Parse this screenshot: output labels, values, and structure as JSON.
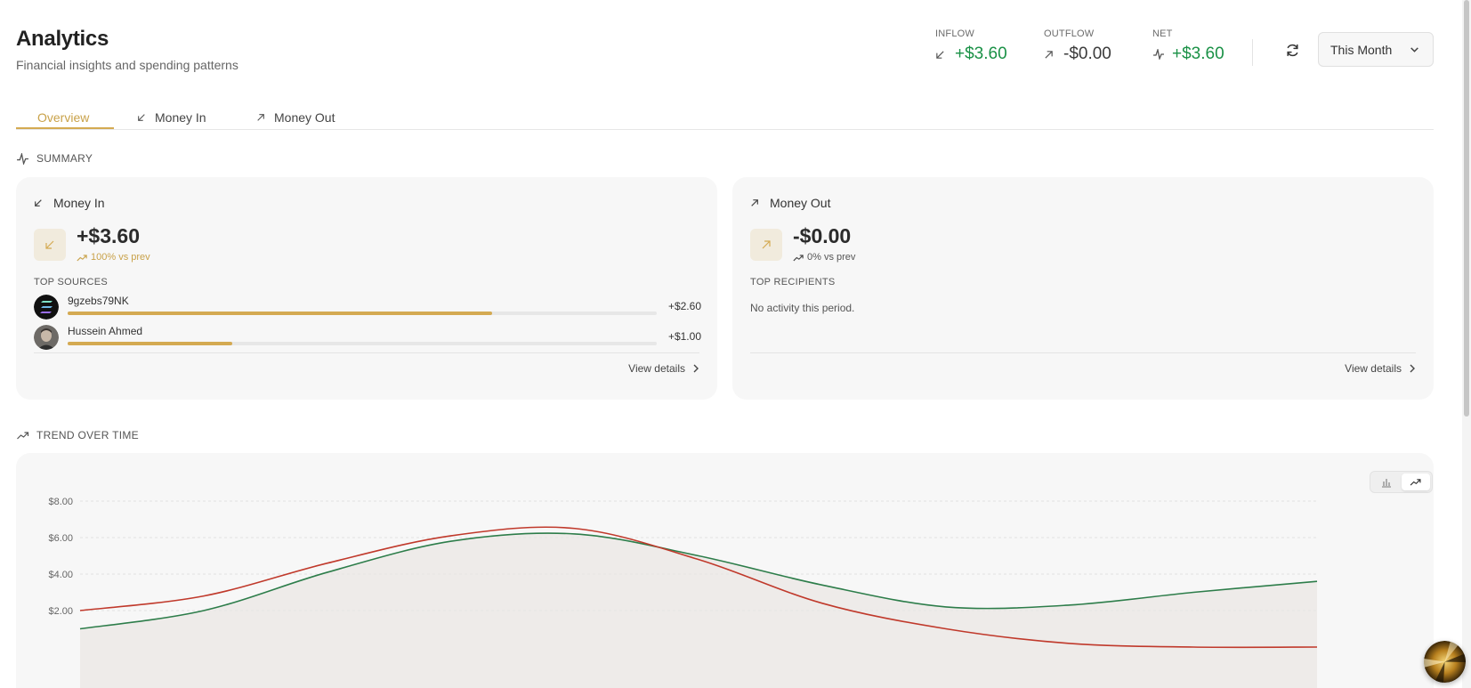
{
  "header": {
    "title": "Analytics",
    "subtitle": "Financial insights and spending patterns"
  },
  "stats": [
    {
      "label": "INFLOW",
      "value": "+$3.60",
      "icon": "arrow-down-left-icon",
      "color": "#1a9146"
    },
    {
      "label": "OUTFLOW",
      "value": "-$0.00",
      "icon": "arrow-up-right-icon",
      "color": "#3a3a3a"
    },
    {
      "label": "NET",
      "value": "+$3.60",
      "icon": "activity-icon",
      "color": "#1a9146"
    }
  ],
  "period": {
    "selected": "This Month"
  },
  "tabs": [
    {
      "label": "Overview",
      "active": true
    },
    {
      "label": "Money In",
      "icon": "arrow-down-left-icon"
    },
    {
      "label": "Money Out",
      "icon": "arrow-up-right-icon"
    }
  ],
  "summary": {
    "label": "SUMMARY",
    "money_in": {
      "title": "Money In",
      "amount": "+$3.60",
      "delta": "100% vs prev",
      "list_title": "TOP SOURCES",
      "sources": [
        {
          "name": "9gzebs79NK",
          "amount": "+$2.60",
          "share": 0.72
        },
        {
          "name": "Hussein Ahmed",
          "amount": "+$1.00",
          "share": 0.28
        }
      ],
      "view_details": "View details"
    },
    "money_out": {
      "title": "Money Out",
      "amount": "-$0.00",
      "delta": "0% vs prev",
      "list_title": "TOP RECIPIENTS",
      "empty_text": "No activity this period.",
      "view_details": "View details"
    }
  },
  "trend": {
    "label": "TREND OVER TIME",
    "view_mode": "line"
  },
  "colors": {
    "accent": "#d4aa52",
    "positive": "#1a9146",
    "inflow_line": "#2d7d4a",
    "outflow_line": "#c0392b"
  },
  "chart_data": {
    "type": "line",
    "y_ticks": [
      "$8.00",
      "$6.00",
      "$4.00",
      "$2.00"
    ],
    "ylim": [
      0,
      8
    ],
    "grid": true,
    "x": [
      0,
      1,
      2,
      3,
      4,
      5,
      6,
      7,
      8,
      9,
      10
    ],
    "series": [
      {
        "color": "#2d7d4a",
        "values": [
          1.0,
          2.0,
          4.1,
          5.8,
          6.2,
          5.0,
          3.4,
          2.2,
          2.3,
          3.0,
          3.6
        ]
      },
      {
        "color": "#c0392b",
        "values": [
          2.0,
          2.8,
          4.6,
          6.1,
          6.5,
          4.8,
          2.4,
          1.0,
          0.2,
          0,
          0
        ]
      }
    ]
  }
}
